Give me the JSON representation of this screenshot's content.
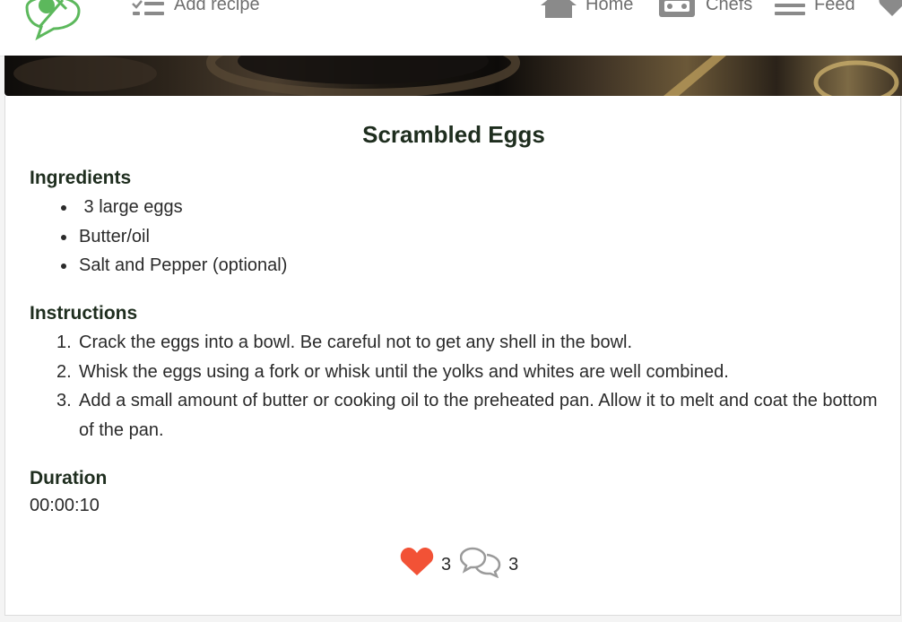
{
  "navbar": {
    "add_recipe_label": "Add recipe",
    "home_label": "Home",
    "chefs_label": "Chefs",
    "feed_label": "Feed"
  },
  "recipe": {
    "title": "Scrambled Eggs",
    "ingredients_heading": "Ingredients",
    "ingredients": [
      " 3 large eggs",
      "Butter/oil",
      "Salt and Pepper (optional)"
    ],
    "instructions_heading": "Instructions",
    "instructions": [
      "Crack the eggs into a bowl. Be careful not to get any shell in the bowl.",
      "Whisk the eggs using a fork or whisk until the yolks and whites are well combined.",
      "Add a small amount of butter or cooking oil to the preheated pan. Allow it to melt and coat the bottom of the pan."
    ],
    "duration_heading": "Duration",
    "duration": "00:00:10",
    "likes_count": "3",
    "comments_count": "3"
  },
  "colors": {
    "brand_green": "#5cb85c",
    "heart_red": "#f25236",
    "nav_gray": "#6f6f6f",
    "text_dark": "#1e2d1e"
  },
  "icons": {
    "logo": "logo-icon",
    "add_recipe": "checklist-icon",
    "home": "home-icon",
    "chefs": "chef-stove-icon",
    "feed": "feed-lines-icon",
    "favorites": "heart-icon",
    "like": "heart-icon",
    "comments": "comment-icon"
  }
}
